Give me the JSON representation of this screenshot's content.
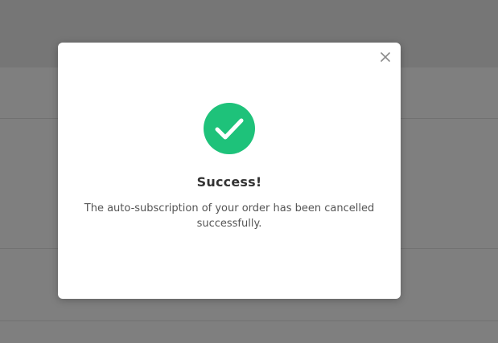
{
  "modal": {
    "title": "Success!",
    "message": "The auto-subscription of your order has been cancelled successfully.",
    "icons": {
      "status": "check-circle-icon",
      "close": "close-icon"
    },
    "colors": {
      "success": "#1ec27a",
      "overlay": "rgba(0,0,0,0.5)"
    }
  }
}
